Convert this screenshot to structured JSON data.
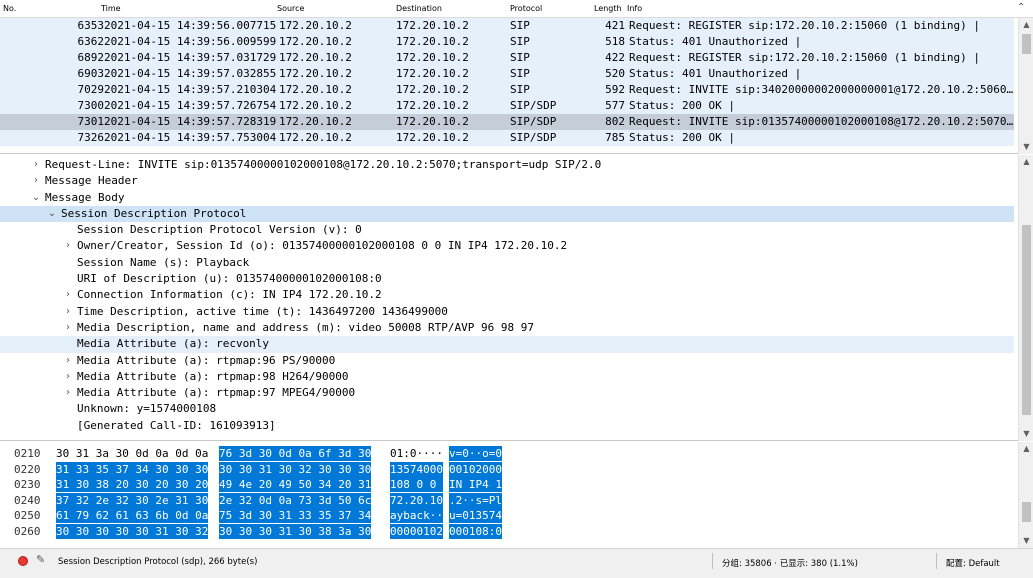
{
  "packet_list": {
    "columns": {
      "no": "No.",
      "time": "Time",
      "source": "Source",
      "destination": "Destination",
      "protocol": "Protocol",
      "length": "Length",
      "info": "Info"
    },
    "rows": [
      {
        "no": "6353",
        "time": "2021-04-15 14:39:56.007715",
        "source": "172.20.10.2",
        "destination": "172.20.10.2",
        "protocol": "SIP",
        "length": "421",
        "info": "Request: REGISTER sip:172.20.10.2:15060  (1 binding) |"
      },
      {
        "no": "6362",
        "time": "2021-04-15 14:39:56.009599",
        "source": "172.20.10.2",
        "destination": "172.20.10.2",
        "protocol": "SIP",
        "length": "518",
        "info": "Status: 401 Unauthorized |"
      },
      {
        "no": "6892",
        "time": "2021-04-15 14:39:57.031729",
        "source": "172.20.10.2",
        "destination": "172.20.10.2",
        "protocol": "SIP",
        "length": "422",
        "info": "Request: REGISTER sip:172.20.10.2:15060  (1 binding) |"
      },
      {
        "no": "6903",
        "time": "2021-04-15 14:39:57.032855",
        "source": "172.20.10.2",
        "destination": "172.20.10.2",
        "protocol": "SIP",
        "length": "520",
        "info": "Status: 401 Unauthorized |"
      },
      {
        "no": "7029",
        "time": "2021-04-15 14:39:57.210304",
        "source": "172.20.10.2",
        "destination": "172.20.10.2",
        "protocol": "SIP",
        "length": "592",
        "info": "Request: INVITE sip:34020000002000000001@172.20.10.2:5060…"
      },
      {
        "no": "7300",
        "time": "2021-04-15 14:39:57.726754",
        "source": "172.20.10.2",
        "destination": "172.20.10.2",
        "protocol": "SIP/SDP",
        "length": "577",
        "info": "Status: 200 OK |"
      },
      {
        "no": "7301",
        "time": "2021-04-15 14:39:57.728319",
        "source": "172.20.10.2",
        "destination": "172.20.10.2",
        "protocol": "SIP/SDP",
        "length": "802",
        "info": "Request: INVITE sip:01357400000102000108@172.20.10.2:5070…"
      },
      {
        "no": "7326",
        "time": "2021-04-15 14:39:57.753004",
        "source": "172.20.10.2",
        "destination": "172.20.10.2",
        "protocol": "SIP/SDP",
        "length": "785",
        "info": "Status: 200 OK |"
      }
    ],
    "selected_row": "7301"
  },
  "details": {
    "rows": [
      {
        "indent": 0,
        "expander": "›",
        "text": "Request-Line: INVITE sip:01357400000102000108@172.20.10.2:5070;transport=udp SIP/2.0"
      },
      {
        "indent": 0,
        "expander": "›",
        "text": "Message Header"
      },
      {
        "indent": 0,
        "expander": "⌄",
        "text": "Message Body"
      },
      {
        "indent": 1,
        "expander": "⌄",
        "text": "Session Description Protocol"
      },
      {
        "indent": 2,
        "expander": "",
        "text": "Session Description Protocol Version (v): 0"
      },
      {
        "indent": 2,
        "expander": "›",
        "text": "Owner/Creator, Session Id (o): 01357400000102000108 0 0 IN IP4 172.20.10.2"
      },
      {
        "indent": 2,
        "expander": "",
        "text": "Session Name (s): Playback"
      },
      {
        "indent": 2,
        "expander": "",
        "text": "URI of Description (u): 01357400000102000108:0"
      },
      {
        "indent": 2,
        "expander": "›",
        "text": "Connection Information (c): IN IP4 172.20.10.2"
      },
      {
        "indent": 2,
        "expander": "›",
        "text": "Time Description, active time (t): 1436497200 1436499000"
      },
      {
        "indent": 2,
        "expander": "›",
        "text": "Media Description, name and address (m): video 50008 RTP/AVP 96 98 97"
      },
      {
        "indent": 2,
        "expander": "",
        "text": "Media Attribute (a): recvonly"
      },
      {
        "indent": 2,
        "expander": "›",
        "text": "Media Attribute (a): rtpmap:96 PS/90000"
      },
      {
        "indent": 2,
        "expander": "›",
        "text": "Media Attribute (a): rtpmap:98 H264/90000"
      },
      {
        "indent": 2,
        "expander": "›",
        "text": "Media Attribute (a): rtpmap:97 MPEG4/90000"
      },
      {
        "indent": 2,
        "expander": "",
        "text": "Unknown: y=1574000108"
      },
      {
        "indent": 2,
        "expander": "",
        "text": "[Generated Call-ID: 161093913]"
      }
    ],
    "highlighted_row": 3,
    "light_highlight_row": 11
  },
  "bytes": {
    "rows": [
      {
        "offset": "0210",
        "hex_a": "30 31 3a 30 0d 0a 0d 0a",
        "hex_b": "76 3d 30 0d 0a 6f 3d 30",
        "ascii_a": "01:0····",
        "ascii_b": "v=0··o=0",
        "hl_start": "b"
      },
      {
        "offset": "0220",
        "hex_a": "31 33 35 37 34 30 30 30",
        "hex_b": "30 30 31 30 32 30 30 30",
        "ascii_a": "13574000",
        "ascii_b": "00102000",
        "hl_start": "a"
      },
      {
        "offset": "0230",
        "hex_a": "31 30 38 20 30 20 30 20",
        "hex_b": "49 4e 20 49 50 34 20 31",
        "ascii_a": "108 0 0 ",
        "ascii_b": "IN IP4 1",
        "hl_start": "a"
      },
      {
        "offset": "0240",
        "hex_a": "37 32 2e 32 30 2e 31 30",
        "hex_b": "2e 32 0d 0a 73 3d 50 6c",
        "ascii_a": "72.20.10",
        "ascii_b": ".2··s=Pl",
        "hl_start": "a"
      },
      {
        "offset": "0250",
        "hex_a": "61 79 62 61 63 6b 0d 0a",
        "hex_b": "75 3d 30 31 33 35 37 34",
        "ascii_a": "ayback··",
        "ascii_b": "u=013574",
        "hl_start": "a"
      },
      {
        "offset": "0260",
        "hex_a": "30 30 30 30 30 31 30 32",
        "hex_b": "30 30 30 31 30 38 3a 30",
        "ascii_a": "00000102",
        "ascii_b": "000108:0",
        "hl_start": "a"
      }
    ]
  },
  "status_bar": {
    "text": "Session Description Protocol (sdp), 266 byte(s)",
    "packets": "分组: 35806 · 已显示: 380 (1.1%)",
    "profile": "配置: Default",
    "record_color": "#e53935"
  },
  "colors": {
    "row_bg": "#e6f0fb",
    "selected_row_bg": "#c5ced8",
    "detail_highlight": "#cfe3f6",
    "bytes_highlight": "#0078d7"
  }
}
